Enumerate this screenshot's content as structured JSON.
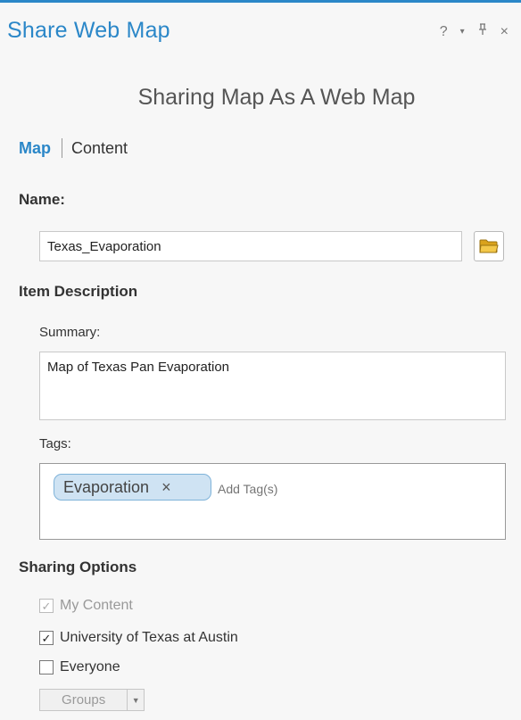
{
  "pane": {
    "title": "Share Web Map",
    "controls": {
      "help": "?",
      "dropdown": "▾",
      "pin": "ᚡ",
      "close": "×"
    }
  },
  "heading": "Sharing Map As A Web Map",
  "tabs": [
    {
      "label": "Map",
      "active": true
    },
    {
      "label": "Content",
      "active": false
    }
  ],
  "name": {
    "label": "Name:",
    "value": "Texas_Evaporation"
  },
  "item_description": {
    "label": "Item Description",
    "summary_label": "Summary:",
    "summary_value": "Map of Texas Pan Evaporation",
    "tags_label": "Tags:",
    "tags": [
      "Evaporation"
    ],
    "tag_remove": "×",
    "add_tag_placeholder": "Add Tag(s)"
  },
  "sharing_options": {
    "label": "Sharing Options",
    "options": [
      {
        "label": "My Content",
        "checked": true,
        "disabled": true
      },
      {
        "label": "University of Texas at Austin",
        "checked": true,
        "disabled": false
      },
      {
        "label": "Everyone",
        "checked": false,
        "disabled": false
      }
    ],
    "groups_label": "Groups"
  },
  "colors": {
    "accent": "#2b87c8",
    "tag_bg": "#cfe3f3",
    "folder": "#e8b531"
  }
}
